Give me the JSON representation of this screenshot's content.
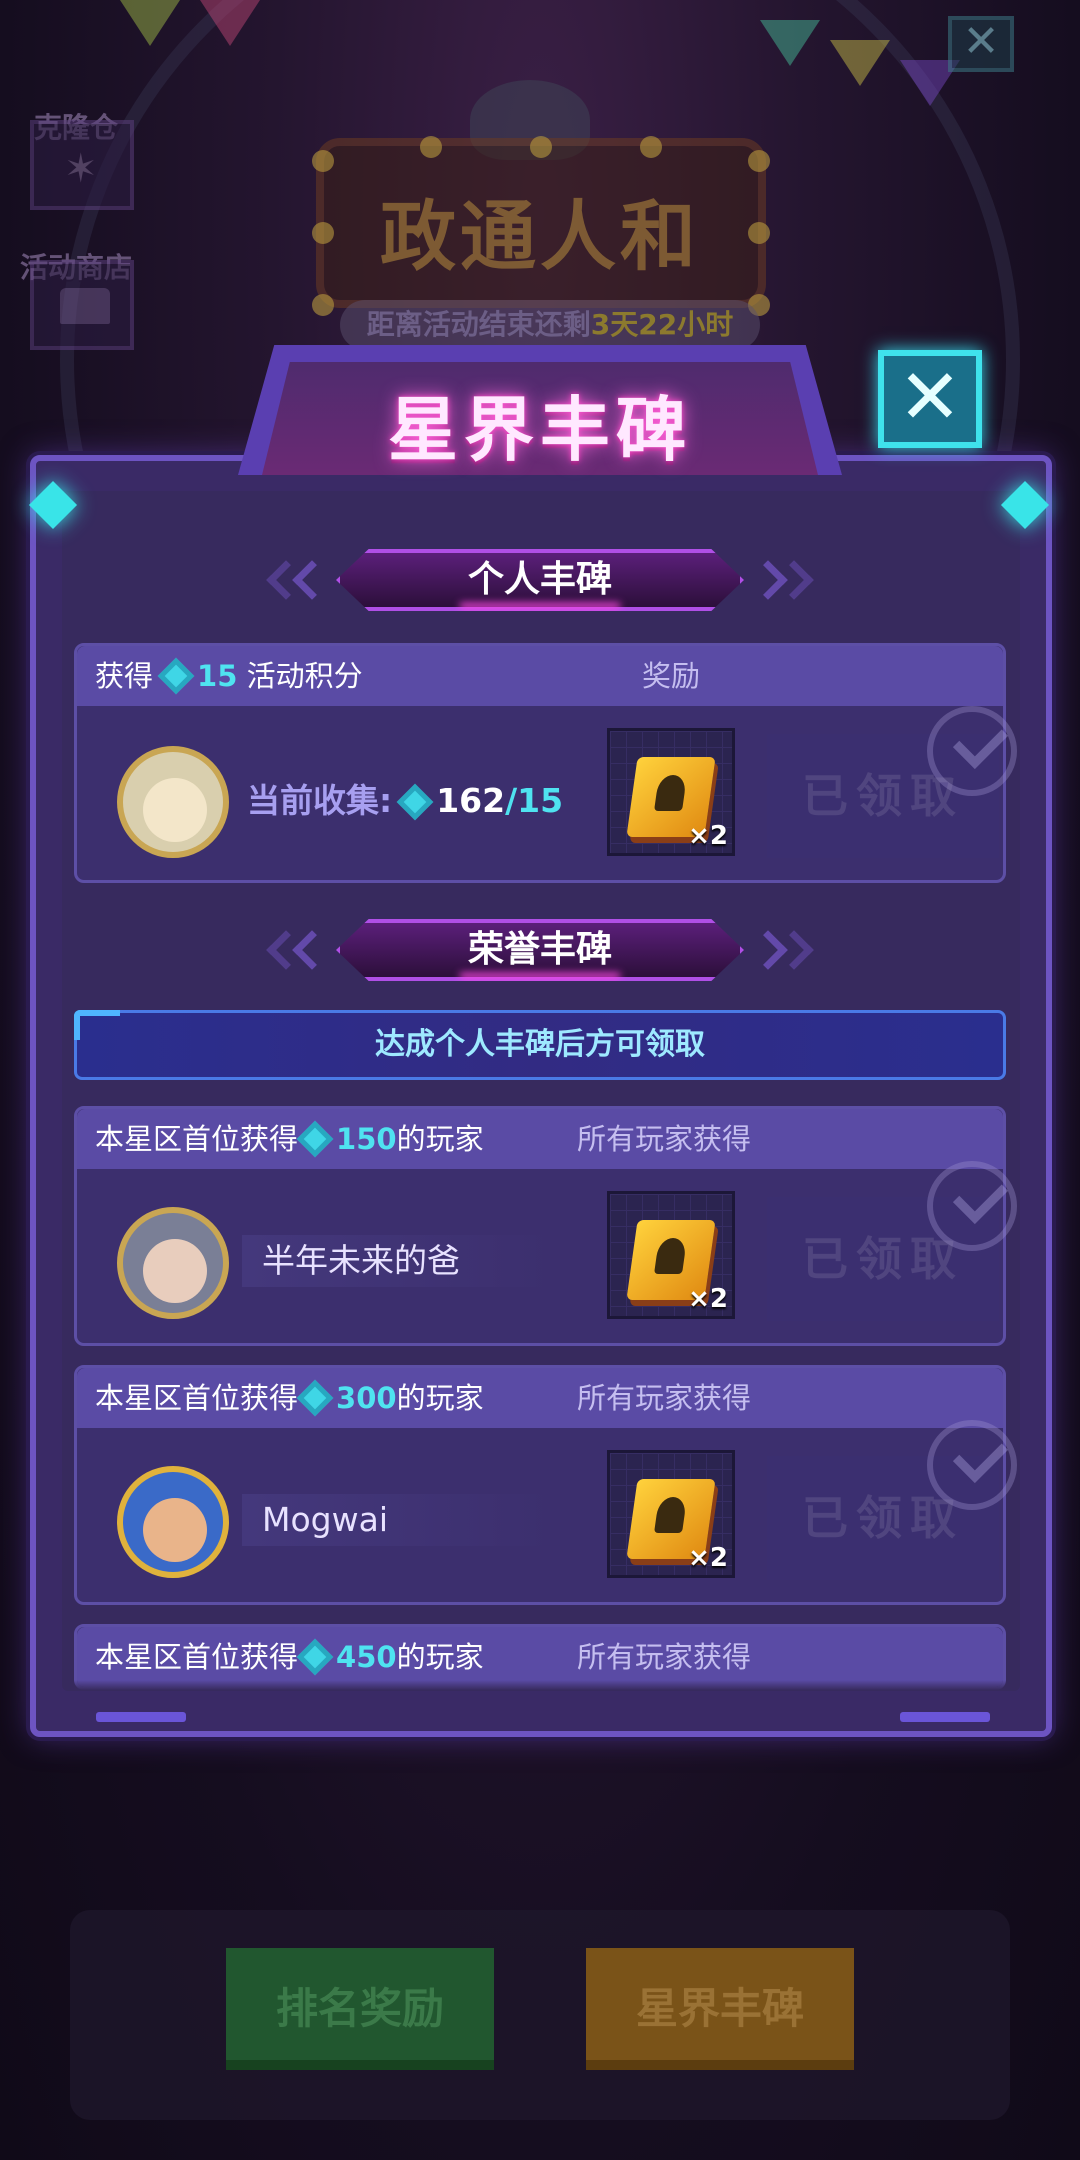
{
  "background": {
    "side_buttons": [
      {
        "label": "克隆仓",
        "icon": "dna-icon"
      },
      {
        "label": "活动商店",
        "icon": "shop-icon"
      }
    ],
    "title": "政通人和",
    "countdown_prefix": "距离活动结束还剩",
    "countdown_value": "3天22小时",
    "close_glyph": "✕",
    "bottom_buttons": [
      {
        "label": "排名奖励",
        "color": "#21572f"
      },
      {
        "label": "星界丰碑",
        "color": "#7a5318"
      }
    ]
  },
  "modal": {
    "title": "星界丰碑",
    "close_glyph": "✕",
    "accent_color": "#6d54c2"
  },
  "personal": {
    "section_title": "个人丰碑",
    "head_prefix": "获得",
    "head_value": "15",
    "head_suffix": "活动积分",
    "reward_label": "奖励",
    "collect_label": "当前收集:",
    "collect_value": "162",
    "collect_goal": "/15",
    "item_count": "×2",
    "claim_label": "已领取"
  },
  "honor": {
    "section_title": "荣誉丰碑",
    "notice": "达成个人丰碑后方可领取",
    "rows": [
      {
        "prefix": "本星区首位获得",
        "value": "150",
        "suffix": "的玩家",
        "reward_label": "所有玩家获得",
        "player": "半年未来的爸",
        "item_count": "×2",
        "claim_label": "已领取"
      },
      {
        "prefix": "本星区首位获得",
        "value": "300",
        "suffix": "的玩家",
        "reward_label": "所有玩家获得",
        "player": "Mogwai",
        "item_count": "×2",
        "claim_label": "已领取"
      },
      {
        "prefix": "本星区首位获得",
        "value": "450",
        "suffix": "的玩家",
        "reward_label": "所有玩家获得"
      }
    ]
  },
  "colors": {
    "gem": "#3fd6e6",
    "highlight_number": "#4fe3f0",
    "claimed_text": "#50457f"
  }
}
